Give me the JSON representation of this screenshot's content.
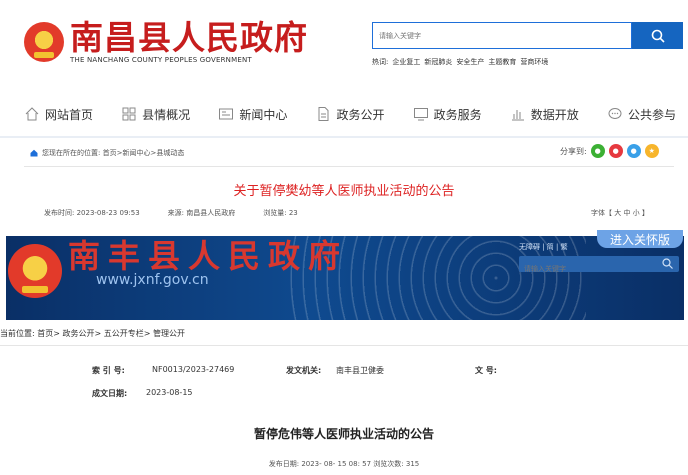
{
  "site1": {
    "title": "南昌县人民政府",
    "subtitle": "THE NANCHANG COUNTY PEOPLES GOVERNMENT",
    "search_placeholder": "请输入关键字",
    "hot_words": [
      "热词:",
      "企业复工",
      "新冠肺炎",
      "安全生产",
      "主题教育",
      "营商环境"
    ],
    "nav": [
      {
        "label": "网站首页",
        "icon": "house-icon"
      },
      {
        "label": "县情概况",
        "icon": "grid-icon"
      },
      {
        "label": "新闻中心",
        "icon": "news-icon"
      },
      {
        "label": "政务公开",
        "icon": "document-icon"
      },
      {
        "label": "政务服务",
        "icon": "monitor-icon"
      },
      {
        "label": "数据开放",
        "icon": "bar-chart-icon"
      },
      {
        "label": "公共参与",
        "icon": "chat-icon"
      }
    ],
    "breadcrumb": "您现在所在的位置: 首页>新闻中心>县城动态",
    "share_label": "分享到:",
    "article_title": "关于暂停樊幼等人医师执业活动的公告",
    "publish_time": "发布时间:  2023-08-23 09:53",
    "source": "来源:  南昌县人民政府",
    "views": "浏览量:  23",
    "font_size_ctrl": "字体【 大  中  小 】"
  },
  "site2": {
    "title": "南丰县人民政府",
    "domain": "www.jxnf.gov.cn",
    "top_links": "无障碍 | 简 | 繁",
    "enter_button": "进入关怀版",
    "search_placeholder": "请输入关键字",
    "breadcrumb": "当前位置:  首页> 政务公开> 五公开专栏> 管理公开",
    "index_label": "索  引  号:",
    "index_value": "NF0013/2023-27469",
    "issuer_label": "发文机关:",
    "issuer_value": "南丰县卫健委",
    "doc_no_label": "文        号:",
    "doc_no_value": "",
    "date_label": "成文日期:",
    "date_value": "2023-08-15",
    "article_title": "暂停危伟等人医师执业活动的公告",
    "meta": "发布日期:  2023- 08- 15 08: 57  浏览次数:  315"
  },
  "colors": {
    "brand_red": "#c61d1d",
    "title_red": "#dd2222",
    "nav_blue": "#1565c0",
    "banner_blue": "#0b3a78"
  }
}
